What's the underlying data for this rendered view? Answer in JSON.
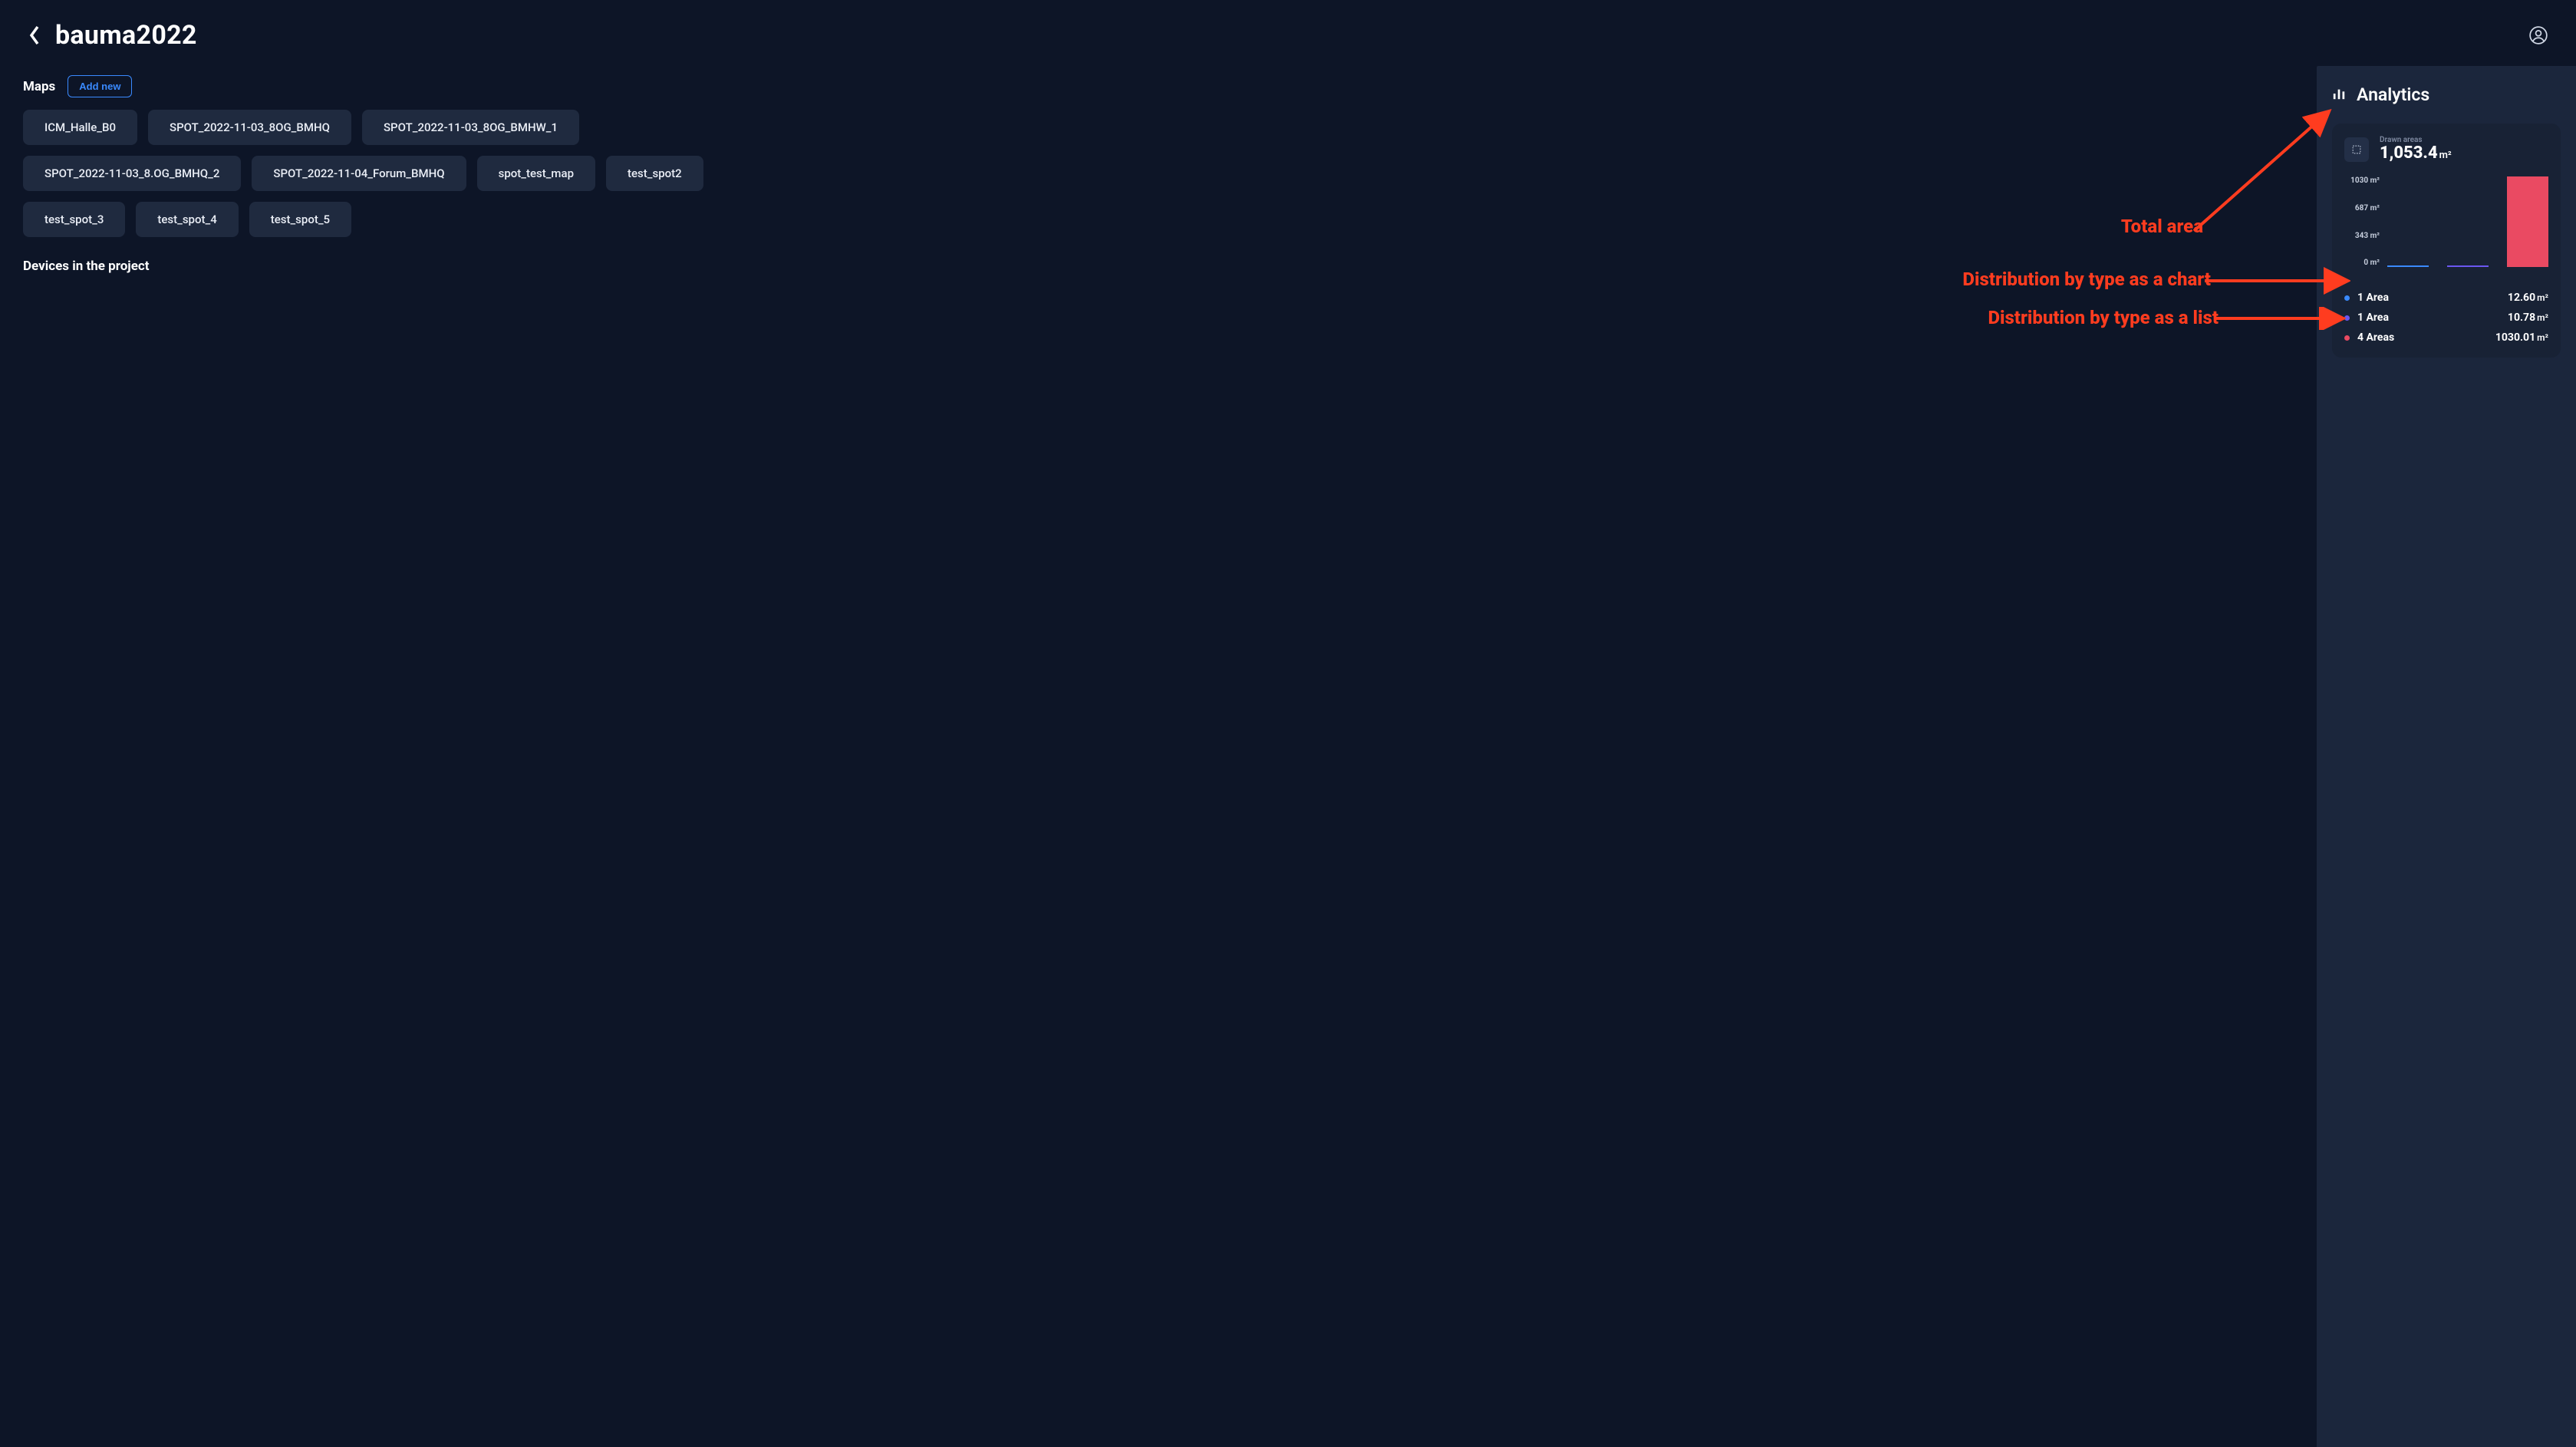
{
  "header": {
    "title": "bauma2022"
  },
  "maps": {
    "section_label": "Maps",
    "add_new_label": "Add new",
    "items": [
      "ICM_Halle_B0",
      "SPOT_2022-11-03_8OG_BMHQ",
      "SPOT_2022-11-03_8OG_BMHW_1",
      "SPOT_2022-11-03_8.OG_BMHQ_2",
      "SPOT_2022-11-04_Forum_BMHQ",
      "spot_test_map",
      "test_spot2",
      "test_spot_3",
      "test_spot_4",
      "test_spot_5"
    ]
  },
  "devices": {
    "section_title": "Devices in the project"
  },
  "analytics": {
    "panel_title": "Analytics",
    "drawn_areas_label": "Drawn areas",
    "total_value": "1,053.4",
    "total_unit": "m²",
    "distribution": [
      {
        "color": "blue",
        "count_label": "1 Area",
        "value": "12.60",
        "unit": "m²"
      },
      {
        "color": "purple",
        "count_label": "1 Area",
        "value": "10.78",
        "unit": "m²"
      },
      {
        "color": "red",
        "count_label": "4 Areas",
        "value": "1030.01",
        "unit": "m²"
      }
    ]
  },
  "annotations": {
    "total_area": "Total area",
    "chart_label": "Distribution by type as a chart",
    "list_label": "Distribution by type as a list"
  },
  "chart_data": {
    "type": "bar",
    "title": "Drawn areas",
    "ylabel": "m²",
    "ylim": [
      0,
      1030
    ],
    "y_ticks": [
      "1030 m²",
      "687 m²",
      "343 m²",
      "0 m²"
    ],
    "categories": [
      "blue",
      "purple",
      "red"
    ],
    "values": [
      12.6,
      10.78,
      1030.01
    ],
    "colors": {
      "blue": "#3a8aff",
      "purple": "#6a57f0",
      "red": "#ea4a62"
    }
  }
}
